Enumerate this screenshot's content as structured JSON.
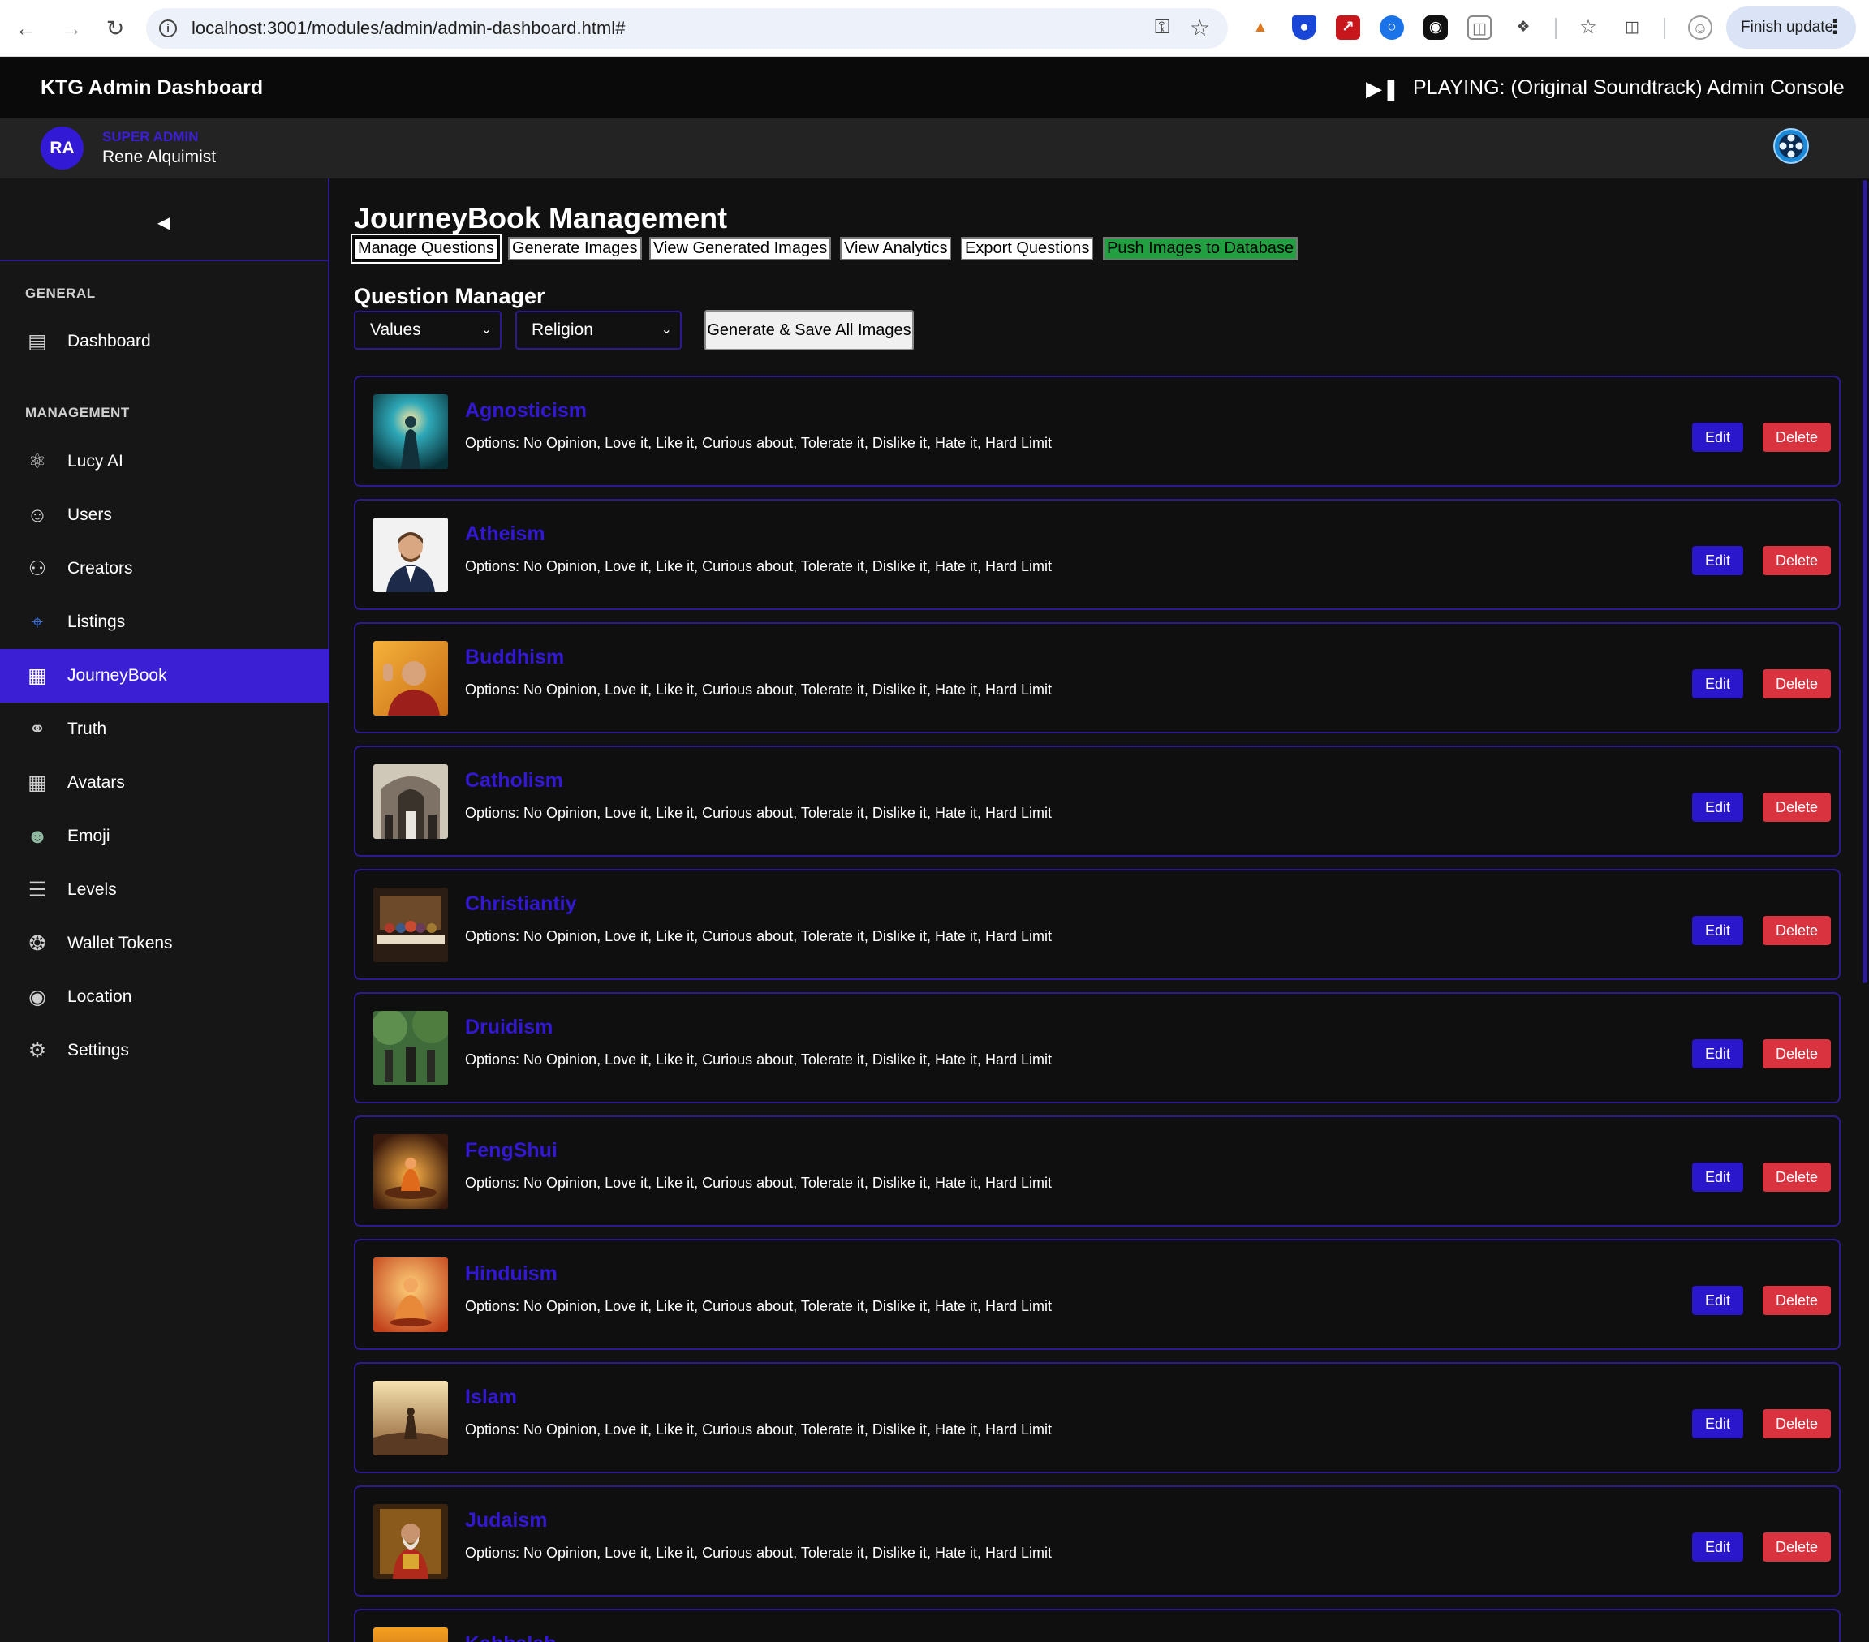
{
  "browser": {
    "url": "localhost:3001/modules/admin/admin-dashboard.html#",
    "finish_update_label": "Finish update",
    "back_icon": "arrow-left-icon",
    "forward_icon": "arrow-right-icon",
    "reload_icon": "reload-icon"
  },
  "header": {
    "title": "KTG Admin Dashboard",
    "now_playing": "PLAYING: (Original Soundtrack) Admin Console"
  },
  "user": {
    "initials": "RA",
    "role": "SUPER ADMIN",
    "name": "Rene Alquimist"
  },
  "sidebar": {
    "general_label": "GENERAL",
    "management_label": "MANAGEMENT",
    "general_items": [
      {
        "label": "Dashboard",
        "icon": "dashboard-icon"
      }
    ],
    "items": [
      {
        "label": "Lucy AI",
        "icon": "atom-icon"
      },
      {
        "label": "Users",
        "icon": "user-icon"
      },
      {
        "label": "Creators",
        "icon": "group-icon"
      },
      {
        "label": "Listings",
        "icon": "crosshair-icon"
      },
      {
        "label": "JourneyBook",
        "icon": "book-icon"
      },
      {
        "label": "Truth",
        "icon": "bomb-icon"
      },
      {
        "label": "Avatars",
        "icon": "grid-icon"
      },
      {
        "label": "Emoji",
        "icon": "alien-icon"
      },
      {
        "label": "Levels",
        "icon": "stack-icon"
      },
      {
        "label": "Wallet Tokens",
        "icon": "token-icon"
      },
      {
        "label": "Location",
        "icon": "location-icon"
      },
      {
        "label": "Settings",
        "icon": "gear-icon"
      }
    ],
    "active_item": "JourneyBook"
  },
  "main": {
    "title": "JourneyBook Management",
    "tabs": [
      "Manage Questions",
      "Generate Images",
      "View Generated Images",
      "View Analytics",
      "Export Questions",
      "Push Images to Database"
    ],
    "section_title": "Question Manager",
    "category_select": "Values",
    "subcategory_select": "Religion",
    "generate_all_label": "Generate & Save All Images",
    "edit_label": "Edit",
    "delete_label": "Delete",
    "questions": [
      {
        "name": "Agnosticism",
        "options": "Options: No Opinion, Love it, Like it, Curious about, Tolerate it, Dislike it, Hate it, Hard Limit"
      },
      {
        "name": "Atheism",
        "options": "Options: No Opinion, Love it, Like it, Curious about, Tolerate it, Dislike it, Hate it, Hard Limit"
      },
      {
        "name": "Buddhism",
        "options": "Options: No Opinion, Love it, Like it, Curious about, Tolerate it, Dislike it, Hate it, Hard Limit"
      },
      {
        "name": "Catholism",
        "options": "Options: No Opinion, Love it, Like it, Curious about, Tolerate it, Dislike it, Hate it, Hard Limit"
      },
      {
        "name": "Christiantiy",
        "options": "Options: No Opinion, Love it, Like it, Curious about, Tolerate it, Dislike it, Hate it, Hard Limit"
      },
      {
        "name": "Druidism",
        "options": "Options: No Opinion, Love it, Like it, Curious about, Tolerate it, Dislike it, Hate it, Hard Limit"
      },
      {
        "name": "FengShui",
        "options": "Options: No Opinion, Love it, Like it, Curious about, Tolerate it, Dislike it, Hate it, Hard Limit"
      },
      {
        "name": "Hinduism",
        "options": "Options: No Opinion, Love it, Like it, Curious about, Tolerate it, Dislike it, Hate it, Hard Limit"
      },
      {
        "name": "Islam",
        "options": "Options: No Opinion, Love it, Like it, Curious about, Tolerate it, Dislike it, Hate it, Hard Limit"
      },
      {
        "name": "Judaism",
        "options": "Options: No Opinion, Love it, Like it, Curious about, Tolerate it, Dislike it, Hate it, Hard Limit"
      },
      {
        "name": "Kabbalah",
        "options": ""
      }
    ]
  },
  "colors": {
    "accent": "#3a1fd4",
    "border": "#2b1b8f",
    "delete": "#d9333f",
    "push_button": "#22a041"
  }
}
